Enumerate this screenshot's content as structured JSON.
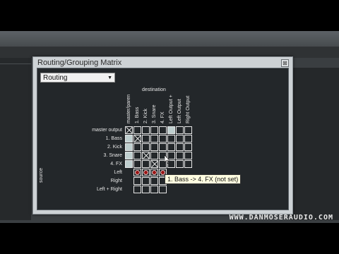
{
  "watermark": "WWW.DANMOSERAUDIO.COM",
  "window": {
    "title": "Routing/Grouping Matrix",
    "close_glyph": "⊠",
    "dropdown_value": "Routing",
    "dropdown_arrow": "▼",
    "destination_label": "destination",
    "source_label": "source"
  },
  "matrix": {
    "columns": [
      "master/paren",
      "1. Bass",
      "2. Kick",
      "3. Snare",
      "4. FX",
      "Left Output +",
      "Left Output",
      "Right Output"
    ],
    "rows": [
      "master output",
      "1. Bass",
      "2. Kick",
      "3. Snare",
      "4. FX",
      "Left",
      "Right",
      "Left + Right"
    ],
    "lit": [
      [
        0,
        5
      ],
      [
        1,
        0
      ],
      [
        2,
        0
      ],
      [
        3,
        0
      ],
      [
        4,
        0
      ]
    ],
    "crossed": [
      [
        0,
        0
      ],
      [
        1,
        1
      ],
      [
        3,
        2
      ],
      [
        4,
        3
      ]
    ],
    "dots": [
      [
        5,
        1
      ],
      [
        5,
        2
      ],
      [
        5,
        3
      ],
      [
        5,
        4
      ]
    ]
  },
  "tooltip": "1. Bass -> 4. FX (not set)"
}
